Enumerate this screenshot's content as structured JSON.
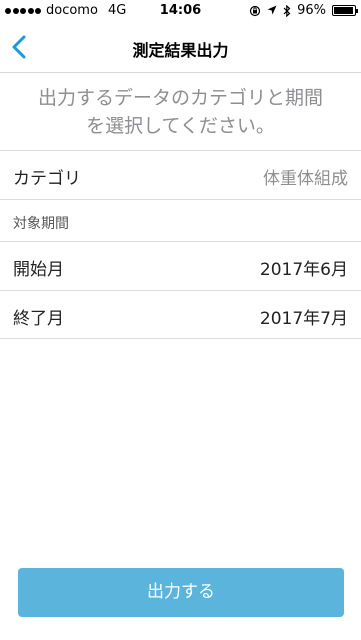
{
  "status_bar": {
    "carrier": "docomo",
    "network": "4G",
    "time": "14:06",
    "battery_percent": "96%",
    "battery_level": 0.96
  },
  "nav": {
    "title": "測定結果出力",
    "back_icon": "chevron-left-icon",
    "accent_color": "#1a9bd7"
  },
  "instruction": {
    "line1": "出力するデータのカテゴリと期間",
    "line2": "を選択してください。"
  },
  "category": {
    "label": "カテゴリ",
    "value": "体重体組成"
  },
  "period": {
    "header": "対象期間",
    "start_label": "開始月",
    "start_value": "2017年6月",
    "end_label": "終了月",
    "end_value": "2017年7月"
  },
  "export_button": {
    "label": "出力する",
    "color": "#5ab4dc"
  }
}
